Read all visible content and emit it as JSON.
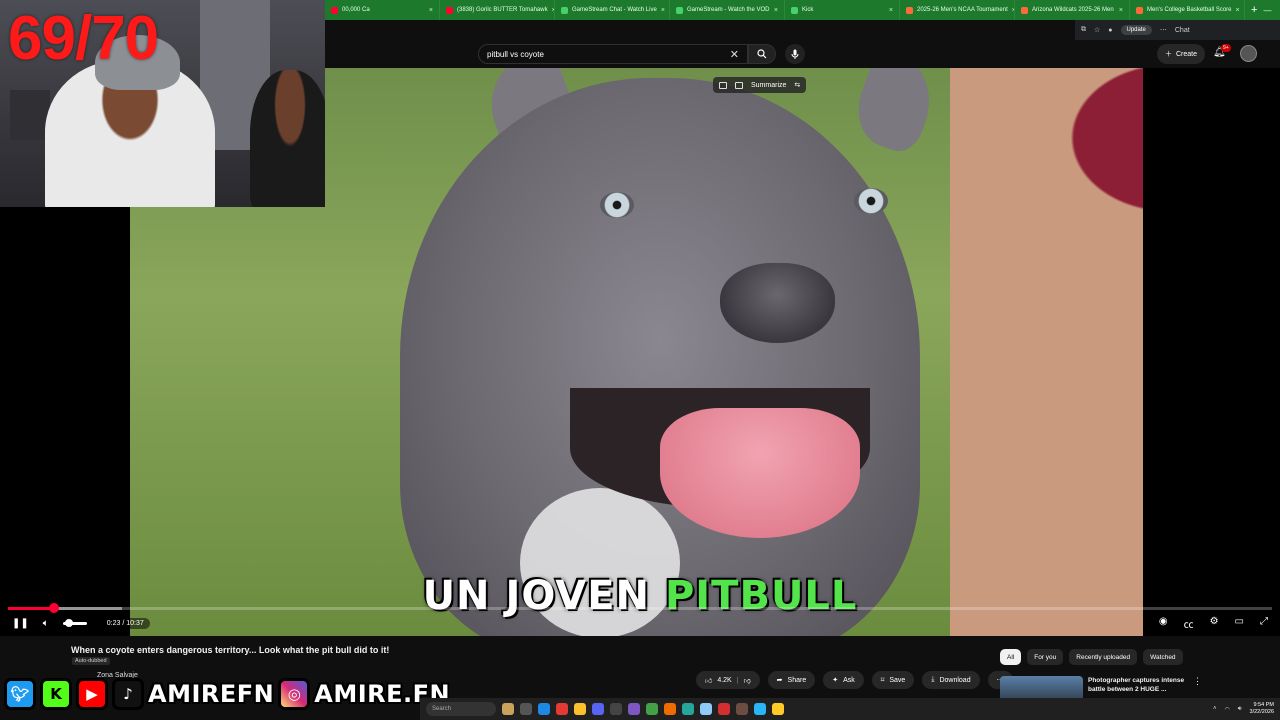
{
  "browser": {
    "tabs": [
      {
        "label": "00,000 Ca",
        "icon": "youtube-icon",
        "color": "#ff0033"
      },
      {
        "label": "(3838) Gorilc BUTTER Tomahawk",
        "icon": "youtube-icon",
        "color": "#ff0033"
      },
      {
        "label": "GameStream Chat - Watch Live",
        "icon": "kick-icon",
        "color": "#47d16a"
      },
      {
        "label": "GameStream - Watch the VOD",
        "icon": "kick-icon",
        "color": "#47d16a"
      },
      {
        "label": "Kick",
        "icon": "kick-icon",
        "color": "#47d16a"
      },
      {
        "label": "2025-26 Men's NCAA Tournament",
        "icon": "gamesite-icon",
        "color": "#ff6a3d"
      },
      {
        "label": "Arizona Wildcats 2025-26 Men",
        "icon": "gamesite-icon",
        "color": "#ff6a3d"
      },
      {
        "label": "Men's College Basketball Score",
        "icon": "gamesite-icon",
        "color": "#ff6a3d"
      }
    ],
    "new_tab": "+",
    "update_label": "Update",
    "chat_label": "Chat"
  },
  "youtube": {
    "search_value": "pitbull vs coyote",
    "create_label": "Create",
    "notif_count": "9+"
  },
  "video": {
    "summarize_label": "Summarize",
    "subtitle_white": "UN JOVEN",
    "subtitle_green": "PITBULL",
    "time_display": "0:23 / 10:37",
    "progress": 0.036,
    "buffered": 0.09
  },
  "info": {
    "title": "When a coyote enters dangerous territory... Look what the pit bull did to it!",
    "auto_dubbed": "Auto-dubbed",
    "channel": "Zona Salvaje",
    "likes": "4.2K",
    "share": "Share",
    "ask": "Ask",
    "save": "Save",
    "download": "Download"
  },
  "chips": [
    "All",
    "For you",
    "Recently uploaded",
    "Watched"
  ],
  "recommendation": {
    "title": "Photographer captures intense battle between 2 HUGE ..."
  },
  "overlay": {
    "counter": "69/70",
    "handle1": "AMIREFN",
    "handle2": "AMIRE.FN"
  },
  "taskbar": {
    "search": "Search",
    "time": "9:54 PM",
    "date": "3/22/2026"
  }
}
